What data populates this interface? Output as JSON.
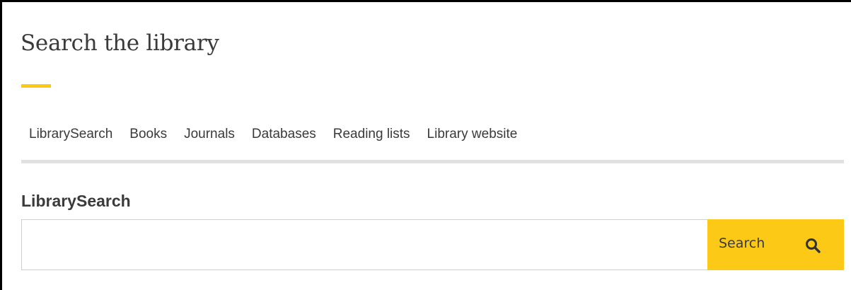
{
  "page": {
    "title": "Search the library"
  },
  "tabs": [
    {
      "label": "LibrarySearch",
      "active": true
    },
    {
      "label": "Books",
      "active": false
    },
    {
      "label": "Journals",
      "active": false
    },
    {
      "label": "Databases",
      "active": false
    },
    {
      "label": "Reading lists",
      "active": false
    },
    {
      "label": "Library website",
      "active": false
    }
  ],
  "search": {
    "heading": "LibrarySearch",
    "value": "",
    "placeholder": "",
    "button_label": "Search",
    "button_icon": "search-icon"
  },
  "colors": {
    "accent": "#fcc917",
    "text": "#3a3a3a",
    "tab_rule": "#e1e1e1",
    "input_border": "#cfcfcf"
  }
}
